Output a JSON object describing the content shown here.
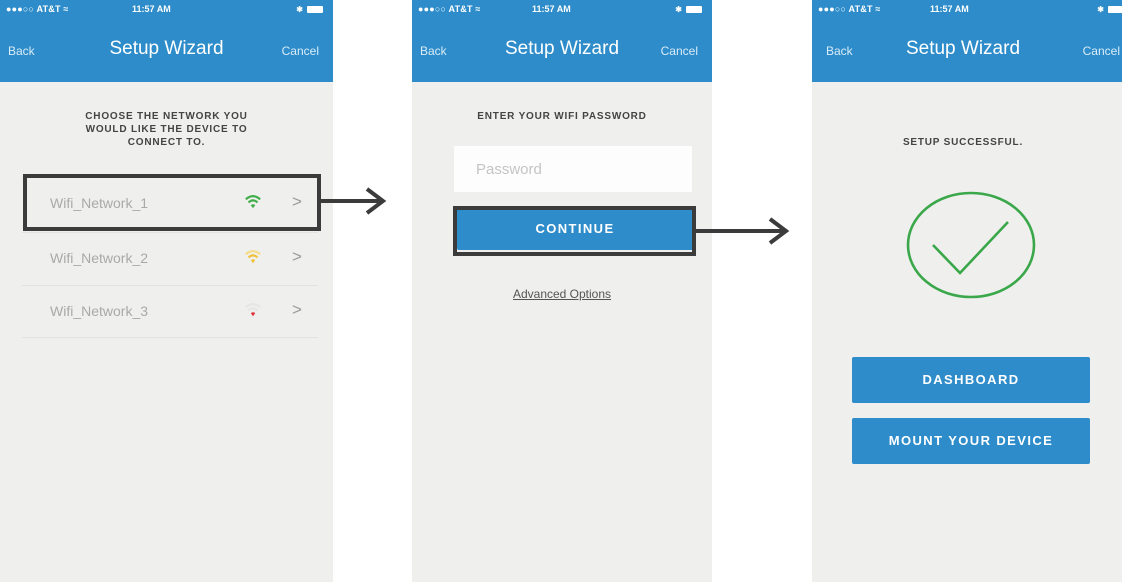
{
  "statusbar": {
    "carrier": "●●●○○ AT&T ≈",
    "time": "11:57 AM",
    "battery": "✱"
  },
  "navbar": {
    "back": "Back",
    "title": "Setup Wizard",
    "cancel": "Cancel"
  },
  "screen1": {
    "heading_lines": [
      "CHOOSE THE NETWORK YOU",
      "WOULD LIKE THE DEVICE TO",
      "CONNECT TO."
    ],
    "networks": [
      {
        "name": "Wifi_Network_1",
        "signal": "strong",
        "color": "#3fae49",
        "chevron": ">"
      },
      {
        "name": "Wifi_Network_2",
        "signal": "medium",
        "color": "#f2c13a",
        "chevron": ">"
      },
      {
        "name": "Wifi_Network_3",
        "signal": "weak",
        "color": "#e0353f",
        "chevron": ">"
      }
    ]
  },
  "screen2": {
    "heading": "ENTER YOUR WIFI PASSWORD",
    "password_placeholder": "Password",
    "continue_label": "CONTINUE",
    "advanced_label": "Advanced Options"
  },
  "screen3": {
    "heading": "SETUP SUCCESSFUL.",
    "success_color": "#3aa84a",
    "dashboard_label": "DASHBOARD",
    "mount_label": "MOUNT YOUR DEVICE"
  },
  "colors": {
    "accent": "#2d8cc9",
    "background": "#efefed",
    "highlight_border": "#3b3b3b"
  },
  "icons": [
    "wifi-icon",
    "chevron-right-icon",
    "checkmark-circle-icon",
    "arrow-right-icon",
    "battery-icon",
    "bluetooth-icon"
  ]
}
